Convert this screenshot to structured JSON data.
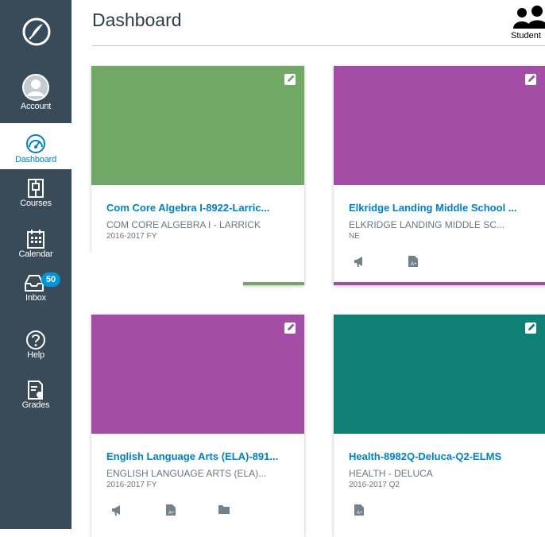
{
  "colors": {
    "sidebar_bg": "#394B58",
    "accent": "#0081C6",
    "green": "#71A866",
    "purple": "#A34DA7",
    "teal": "#0F8174",
    "badge": "#0096DB"
  },
  "header": {
    "title": "Dashboard",
    "student_view_label": "Student"
  },
  "nav": {
    "account": "Account",
    "dashboard": "Dashboard",
    "courses": "Courses",
    "calendar": "Calendar",
    "inbox": "Inbox",
    "inbox_count": "50",
    "help": "Help",
    "grades": "Grades"
  },
  "cards": [
    {
      "title": "Com Core Algebra I-8922-Larric...",
      "subtitle": "COM CORE ALGEBRA I - LARRICK",
      "term": "2016-2017 FY",
      "color": "#71A866"
    },
    {
      "title": "Elkridge Landing Middle School ...",
      "subtitle": "ELKRIDGE LANDING MIDDLE SC...",
      "term": "NE",
      "color": "#A34DA7"
    },
    {
      "title": "English Language Arts (ELA)-891...",
      "subtitle": "ENGLISH LANGUAGE ARTS (ELA)...",
      "term": "2016-2017 FY",
      "color": "#A34DA7"
    },
    {
      "title": "Health-8982Q-Deluca-Q2-ELMS",
      "subtitle": "HEALTH - DELUCA",
      "term": "2016-2017 Q2",
      "color": "#0F8174"
    }
  ]
}
